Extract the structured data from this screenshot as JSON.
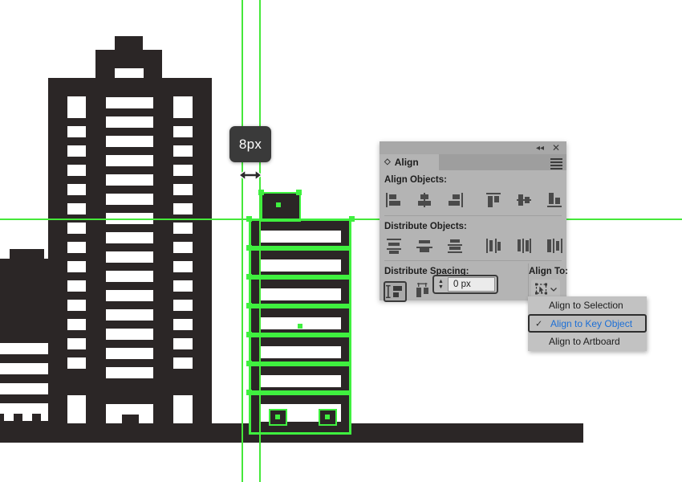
{
  "app": {
    "tooltip_measure": "8px",
    "cursor_icon": "horizontal-resize-cursor"
  },
  "panel": {
    "tab_label": "Align",
    "collapse_icon": "double-chevron-left-icon",
    "close_icon": "close-icon",
    "menu_icon": "panel-menu-icon",
    "sections": {
      "align_objects_label": "Align Objects:",
      "distribute_objects_label": "Distribute Objects:",
      "distribute_spacing_label": "Distribute Spacing:",
      "align_to_label": "Align To:"
    },
    "align_objects_buttons": [
      "align-left-edges",
      "align-horizontal-centers",
      "align-right-edges",
      "align-top-edges",
      "align-vertical-centers",
      "align-bottom-edges"
    ],
    "distribute_objects_buttons": [
      "distribute-top-edges",
      "distribute-vertical-centers",
      "distribute-bottom-edges",
      "distribute-left-edges",
      "distribute-horizontal-centers",
      "distribute-right-edges"
    ],
    "distribute_spacing_buttons": [
      "distribute-vertical-spacing",
      "distribute-horizontal-spacing"
    ],
    "spacing_value": "0 px",
    "spacing_placeholder": "0 px",
    "align_to_icon": "align-to-key-object-icon",
    "align_to_chevron": "chevron-down-icon"
  },
  "dropdown": {
    "items": [
      {
        "label": "Align to Selection",
        "checked": false
      },
      {
        "label": "Align to Key Object",
        "checked": true
      },
      {
        "label": "Align to Artboard",
        "checked": false
      }
    ],
    "check_glyph": "✓"
  },
  "colors": {
    "artwork": "#2b2626",
    "selection": "#3ff03f",
    "guide": "#45e83a",
    "panel_bg": "#b4b4b4",
    "dropdown_highlight_text": "#1c6fd6",
    "tooltip_bg": "#3a3a3a"
  },
  "artwork": {
    "name": "city-buildings-vector",
    "selected_object": "right-building-floor-stack",
    "guides": {
      "vertical": [
        301,
        323
      ],
      "horizontal": [
        272
      ]
    }
  }
}
